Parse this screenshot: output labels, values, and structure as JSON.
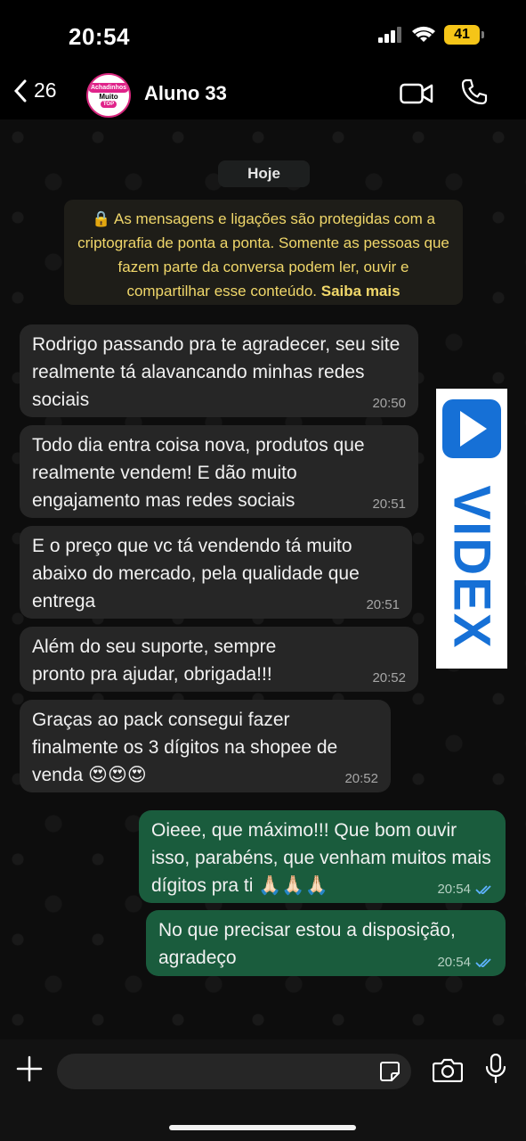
{
  "status": {
    "time": "20:54",
    "battery": "41"
  },
  "header": {
    "back_count": "26",
    "contact_name": "Aluno 33",
    "avatar_text": [
      "Achadinhos",
      "Muito",
      "TOP"
    ]
  },
  "chat": {
    "date_label": "Hoje",
    "encryption_notice": "As mensagens e ligações são protegidas com a criptografia de ponta a ponta. Somente as pessoas que fazem parte da conversa podem ler, ouvir e compartilhar esse conteúdo.",
    "learn_more": "Saiba mais",
    "messages": [
      {
        "dir": "in",
        "text": "Rodrigo passando pra te agradecer, seu site realmente tá alavancando minhas redes sociais",
        "time": "20:50"
      },
      {
        "dir": "in",
        "text": "Todo dia entra coisa nova, produtos que realmente vendem! E dão muito engajamento mas redes sociais",
        "time": "20:51"
      },
      {
        "dir": "in",
        "text": "E o preço que vc tá vendendo tá muito abaixo do mercado, pela qualidade que entrega",
        "time": "20:51"
      },
      {
        "dir": "in",
        "text": "Além do seu suporte, sempre pronto pra ajudar, obrigada!!!",
        "time": "20:52"
      },
      {
        "dir": "in",
        "text": "Graças ao pack consegui fazer finalmente os 3 dígitos na shopee de venda 😍😍😍",
        "time": "20:52"
      },
      {
        "dir": "out",
        "text": "Oieee, que máximo!!! Que bom ouvir isso, parabéns, que venham muitos mais dígitos pra ti 🙏🏻🙏🏻🙏🏻",
        "time": "20:54"
      },
      {
        "dir": "out",
        "text": "No que precisar estou a disposição, agradeço",
        "time": "20:54"
      }
    ]
  },
  "watermark": {
    "text": "VIDEX",
    "color": "#1670d6"
  },
  "colors": {
    "incoming_bubble": "#262626",
    "outgoing_bubble": "#1a5c3d",
    "encryption_text": "#f0d76a"
  }
}
